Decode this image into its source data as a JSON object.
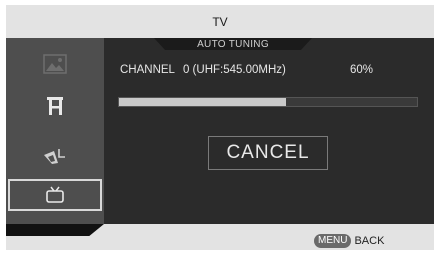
{
  "header": {
    "title": "TV"
  },
  "sidebar": {
    "items": [
      {
        "icon": "picture-icon",
        "selected": false
      },
      {
        "icon": "sound-icon",
        "selected": false
      },
      {
        "icon": "setup-icon",
        "selected": false
      },
      {
        "icon": "tv-icon",
        "selected": true
      }
    ]
  },
  "panel": {
    "tab_title": "AUTO TUNING",
    "channel_label": "CHANNEL",
    "channel_value": "0 (UHF:545.00MHz)",
    "progress_text": "60%",
    "progress_value": 0.56,
    "cancel_label": "CANCEL"
  },
  "footer": {
    "menu_key": "MENU",
    "menu_action": "BACK"
  },
  "colors": {
    "sidebar_bg": "#4e4e4e",
    "panel_bg": "#2b2b2b",
    "frame_bg": "#e3e3e3",
    "progress_fill": "#c9c9c9"
  }
}
